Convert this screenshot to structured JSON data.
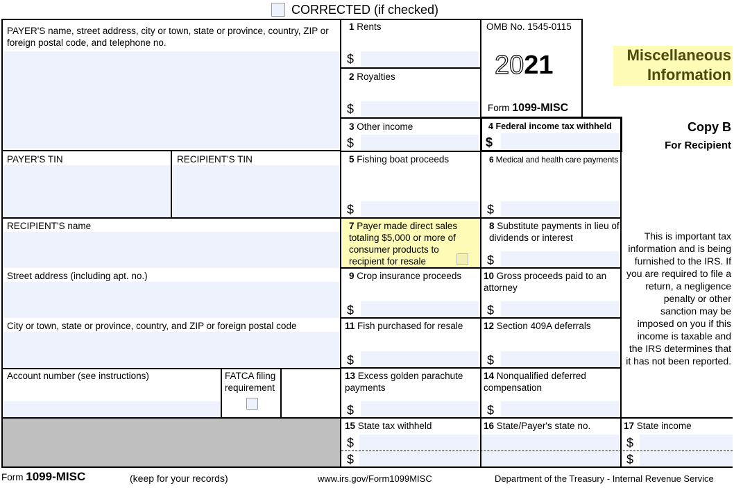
{
  "header": {
    "corrected_label": "CORRECTED (if checked)",
    "corrected_checked": false
  },
  "payer": {
    "info_label": "PAYER'S name, street address, city or town, state or province, country, ZIP or foreign postal code, and telephone no.",
    "info_value": "",
    "tin_label": "PAYER'S TIN",
    "tin_value": ""
  },
  "recipient": {
    "tin_label": "RECIPIENT'S TIN",
    "tin_value": "",
    "name_label": "RECIPIENT'S name",
    "name_value": "",
    "street_label": "Street address (including apt. no.)",
    "street_value": "",
    "city_label": "City or town, state or province, country, and ZIP or foreign postal code",
    "city_value": "",
    "account_label": "Account number (see instructions)",
    "account_value": "",
    "fatca_label_1": "FATCA filing",
    "fatca_label_2": "requirement",
    "fatca_checked": false
  },
  "form_info": {
    "omb": "OMB No. 1545-0115",
    "year_outline": "20",
    "year_bold": "21",
    "form_prefix": "Form",
    "form_name": "1099-MISC",
    "title_line1": "Miscellaneous",
    "title_line2": "Information",
    "copy": "Copy B",
    "copy_for": "For Recipient",
    "notice": "This is important tax information and is being furnished to the IRS. If you are required to file a return, a negligence penalty or other sanction may be imposed on you if this income is taxable and the IRS determines that it has not been reported."
  },
  "currency_symbol": "$",
  "boxes": {
    "b1": {
      "num": "1",
      "label": "Rents",
      "value": ""
    },
    "b2": {
      "num": "2",
      "label": "Royalties",
      "value": ""
    },
    "b3": {
      "num": "3",
      "label": "Other income",
      "value": ""
    },
    "b4": {
      "num": "4",
      "label": "Federal income tax withheld",
      "value": ""
    },
    "b5": {
      "num": "5",
      "label": "Fishing boat proceeds",
      "value": ""
    },
    "b6": {
      "num": "6",
      "label": "Medical and health care payments",
      "value": ""
    },
    "b7": {
      "num": "7",
      "label": "Payer made direct sales totaling $5,000 or more of consumer products to recipient for resale",
      "checked": false
    },
    "b8": {
      "num": "8",
      "label": "Substitute payments in lieu of dividends or interest",
      "value": ""
    },
    "b9": {
      "num": "9",
      "label": "Crop insurance proceeds",
      "value": ""
    },
    "b10": {
      "num": "10",
      "label": "Gross proceeds paid to an attorney",
      "value": ""
    },
    "b11": {
      "num": "11",
      "label": "Fish purchased for resale",
      "value": ""
    },
    "b12": {
      "num": "12",
      "label": "Section 409A deferrals",
      "value": ""
    },
    "b13": {
      "num": "13",
      "label": "Excess golden parachute payments",
      "value": ""
    },
    "b14": {
      "num": "14",
      "label": "Nonqualified deferred compensation",
      "value": ""
    },
    "b15": {
      "num": "15",
      "label": "State tax withheld",
      "value1": "",
      "value2": ""
    },
    "b16": {
      "num": "16",
      "label": "State/Payer's state no.",
      "value1": "",
      "value2": ""
    },
    "b17": {
      "num": "17",
      "label": "State income",
      "value1": "",
      "value2": ""
    }
  },
  "footer": {
    "form_prefix": "Form",
    "form_name": "1099-MISC",
    "keep": "(keep for your records)",
    "url": "www.irs.gov/Form1099MISC",
    "dept": "Department of the Treasury - Internal Revenue Service"
  },
  "colors": {
    "field_fill": "#eef2fd",
    "highlight_yellow": "#fdfbb5",
    "title_text": "#4a4a0a",
    "shaded_gray": "#bfbfbf"
  }
}
